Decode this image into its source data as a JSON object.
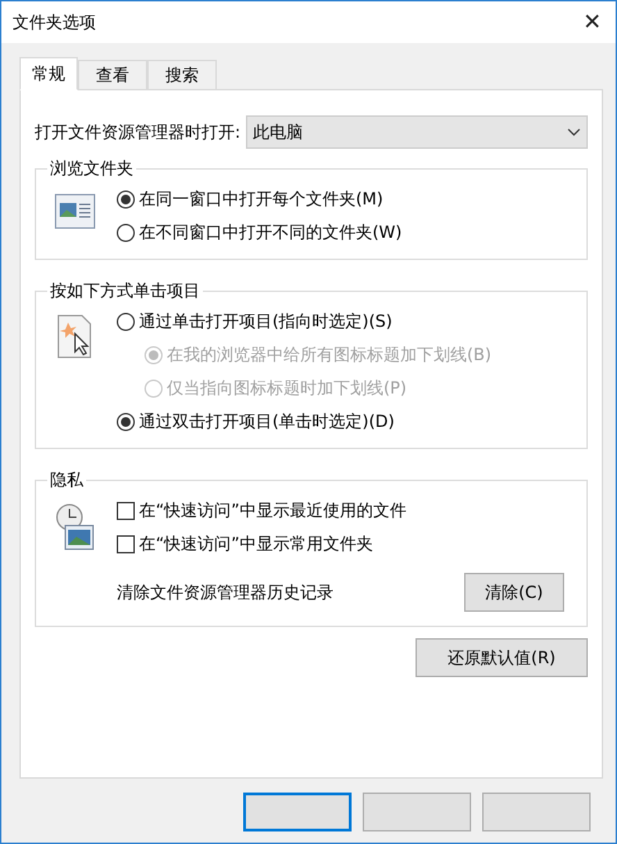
{
  "window": {
    "title": "文件夹选项",
    "close": "✕"
  },
  "tabs": [
    {
      "label": "常规",
      "selected": true
    },
    {
      "label": "查看",
      "selected": false
    },
    {
      "label": "搜索",
      "selected": false
    }
  ],
  "open_in": {
    "label": "打开文件资源管理器时打开:",
    "value": "此电脑"
  },
  "groups": [
    {
      "title": "浏览文件夹",
      "items": [
        {
          "kind": "radio",
          "label": "在同一窗口中打开每个文件夹(M)",
          "selected": true,
          "disabled": false
        },
        {
          "kind": "radio",
          "label": "在不同窗口中打开不同的文件夹(W)",
          "selected": false,
          "disabled": false
        }
      ]
    },
    {
      "title": "按如下方式单击项目",
      "items": [
        {
          "kind": "radio",
          "label": "通过单击打开项目(指向时选定)(S)",
          "selected": false,
          "disabled": false,
          "children": [
            {
              "kind": "radio",
              "label": "在我的浏览器中给所有图标标题加下划线(B)",
              "selected": true,
              "disabled": true
            },
            {
              "kind": "radio",
              "label": "仅当指向图标标题时加下划线(P)",
              "selected": false,
              "disabled": true
            }
          ]
        },
        {
          "kind": "radio",
          "label": "通过双击打开项目(单击时选定)(D)",
          "selected": true,
          "disabled": false
        }
      ]
    },
    {
      "title": "隐私",
      "items": [
        {
          "kind": "checkbox",
          "label": "在“快速访问”中显示最近使用的文件",
          "checked": false
        },
        {
          "kind": "checkbox",
          "label": "在“快速访问”中显示常用文件夹",
          "checked": false
        },
        {
          "kind": "action",
          "label": "清除文件资源管理器历史记录",
          "button": "清除(C)"
        }
      ]
    }
  ],
  "restore_button": "还原默认值(R)"
}
